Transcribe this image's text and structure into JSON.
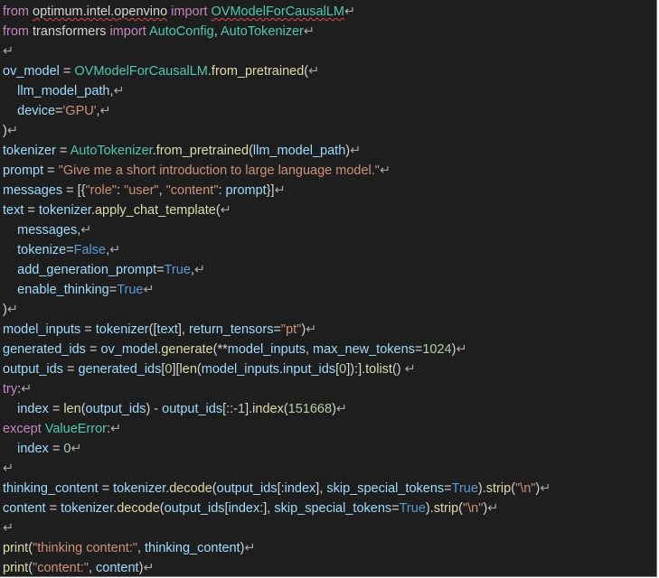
{
  "colors": {
    "background": "#1e1e1e",
    "keyword": "#c586c0",
    "text": "#d4d4d4",
    "class": "#4ec9b0",
    "function": "#dcdcaa",
    "variable": "#9cdcfe",
    "string": "#ce9178",
    "number": "#b5cea8",
    "constant": "#569cd6",
    "paragraph_mark": "#a8a8a8",
    "spellcheck_underline": "#e04848"
  },
  "paragraph_mark": "↵",
  "code_lines": [
    [
      [
        "kw",
        "from "
      ],
      [
        "text",
        "optimum.intel.openvino"
      ],
      [
        "kw",
        " import "
      ],
      [
        "cls",
        "OVModelForCausalLM"
      ]
    ],
    [
      [
        "kw",
        "from "
      ],
      [
        "text",
        "transformers"
      ],
      [
        "kw",
        " import "
      ],
      [
        "cls",
        "AutoConfig"
      ],
      [
        "text",
        ", "
      ],
      [
        "cls",
        "AutoTokenizer"
      ]
    ],
    [],
    [
      [
        "var",
        "ov_model"
      ],
      [
        "text",
        " = "
      ],
      [
        "cls",
        "OVModelForCausalLM"
      ],
      [
        "text",
        "."
      ],
      [
        "fn",
        "from_pretrained"
      ],
      [
        "text",
        "("
      ]
    ],
    [
      [
        "text",
        "    "
      ],
      [
        "var",
        "llm_model_path"
      ],
      [
        "text",
        ","
      ]
    ],
    [
      [
        "text",
        "    "
      ],
      [
        "var",
        "device"
      ],
      [
        "text",
        "="
      ],
      [
        "str",
        "'GPU'"
      ],
      [
        "text",
        ","
      ]
    ],
    [
      [
        "text",
        ")"
      ]
    ],
    [
      [
        "var",
        "tokenizer"
      ],
      [
        "text",
        " = "
      ],
      [
        "cls",
        "AutoTokenizer"
      ],
      [
        "text",
        "."
      ],
      [
        "fn",
        "from_pretrained"
      ],
      [
        "text",
        "("
      ],
      [
        "var",
        "llm_model_path"
      ],
      [
        "text",
        ")"
      ]
    ],
    [
      [
        "var",
        "prompt"
      ],
      [
        "text",
        " = "
      ],
      [
        "str",
        "\"Give me a short introduction to large language model.\""
      ]
    ],
    [
      [
        "var",
        "messages"
      ],
      [
        "text",
        " = [{"
      ],
      [
        "str",
        "\"role\""
      ],
      [
        "text",
        ": "
      ],
      [
        "str",
        "\"user\""
      ],
      [
        "text",
        ", "
      ],
      [
        "str",
        "\"content\""
      ],
      [
        "text",
        ": "
      ],
      [
        "var",
        "prompt"
      ],
      [
        "text",
        "}]"
      ]
    ],
    [
      [
        "var",
        "text"
      ],
      [
        "text",
        " = "
      ],
      [
        "var",
        "tokenizer"
      ],
      [
        "text",
        "."
      ],
      [
        "fn",
        "apply_chat_template"
      ],
      [
        "text",
        "("
      ]
    ],
    [
      [
        "text",
        "    "
      ],
      [
        "var",
        "messages"
      ],
      [
        "text",
        ","
      ]
    ],
    [
      [
        "text",
        "    "
      ],
      [
        "var",
        "tokenize"
      ],
      [
        "text",
        "="
      ],
      [
        "const",
        "False"
      ],
      [
        "text",
        ","
      ]
    ],
    [
      [
        "text",
        "    "
      ],
      [
        "var",
        "add_generation_prompt"
      ],
      [
        "text",
        "="
      ],
      [
        "const",
        "True"
      ],
      [
        "text",
        ","
      ]
    ],
    [
      [
        "text",
        "    "
      ],
      [
        "var",
        "enable_thinking"
      ],
      [
        "text",
        "="
      ],
      [
        "const",
        "True"
      ]
    ],
    [
      [
        "text",
        ")"
      ]
    ],
    [
      [
        "var",
        "model_inputs"
      ],
      [
        "text",
        " = "
      ],
      [
        "var",
        "tokenizer"
      ],
      [
        "text",
        "(["
      ],
      [
        "var",
        "text"
      ],
      [
        "text",
        "], "
      ],
      [
        "var",
        "return_tensors"
      ],
      [
        "text",
        "="
      ],
      [
        "str",
        "\"pt\""
      ],
      [
        "text",
        ")"
      ]
    ],
    [
      [
        "var",
        "generated_ids"
      ],
      [
        "text",
        " = "
      ],
      [
        "var",
        "ov_model"
      ],
      [
        "text",
        "."
      ],
      [
        "fn",
        "generate"
      ],
      [
        "text",
        "(**"
      ],
      [
        "var",
        "model_inputs"
      ],
      [
        "text",
        ", "
      ],
      [
        "var",
        "max_new_tokens"
      ],
      [
        "text",
        "="
      ],
      [
        "num",
        "1024"
      ],
      [
        "text",
        ")"
      ]
    ],
    [
      [
        "var",
        "output_ids"
      ],
      [
        "text",
        " = "
      ],
      [
        "var",
        "generated_ids"
      ],
      [
        "text",
        "["
      ],
      [
        "num",
        "0"
      ],
      [
        "text",
        "]["
      ],
      [
        "fn",
        "len"
      ],
      [
        "text",
        "("
      ],
      [
        "var",
        "model_inputs"
      ],
      [
        "text",
        "."
      ],
      [
        "var",
        "input_ids"
      ],
      [
        "text",
        "["
      ],
      [
        "num",
        "0"
      ],
      [
        "text",
        "]):]."
      ],
      [
        "fn",
        "tolist"
      ],
      [
        "text",
        "() "
      ]
    ],
    [
      [
        "kw",
        "try"
      ],
      [
        "text",
        ":"
      ]
    ],
    [
      [
        "text",
        "    "
      ],
      [
        "var",
        "index"
      ],
      [
        "text",
        " = "
      ],
      [
        "fn",
        "len"
      ],
      [
        "text",
        "("
      ],
      [
        "var",
        "output_ids"
      ],
      [
        "text",
        ") - "
      ],
      [
        "var",
        "output_ids"
      ],
      [
        "text",
        "[::-"
      ],
      [
        "num",
        "1"
      ],
      [
        "text",
        "]."
      ],
      [
        "fn",
        "index"
      ],
      [
        "text",
        "("
      ],
      [
        "num",
        "151668"
      ],
      [
        "text",
        ")"
      ]
    ],
    [
      [
        "kw",
        "except "
      ],
      [
        "cls",
        "ValueError"
      ],
      [
        "text",
        ":"
      ]
    ],
    [
      [
        "text",
        "    "
      ],
      [
        "var",
        "index"
      ],
      [
        "text",
        " = "
      ],
      [
        "num",
        "0"
      ]
    ],
    [],
    [
      [
        "var",
        "thinking_content"
      ],
      [
        "text",
        " = "
      ],
      [
        "var",
        "tokenizer"
      ],
      [
        "text",
        "."
      ],
      [
        "fn",
        "decode"
      ],
      [
        "text",
        "("
      ],
      [
        "var",
        "output_ids"
      ],
      [
        "text",
        "[:"
      ],
      [
        "var",
        "index"
      ],
      [
        "text",
        "], "
      ],
      [
        "var",
        "skip_special_tokens"
      ],
      [
        "text",
        "="
      ],
      [
        "const",
        "True"
      ],
      [
        "text",
        ")."
      ],
      [
        "fn",
        "strip"
      ],
      [
        "text",
        "("
      ],
      [
        "str",
        "\"\\n\""
      ],
      [
        "text",
        ")"
      ]
    ],
    [
      [
        "var",
        "content"
      ],
      [
        "text",
        " = "
      ],
      [
        "var",
        "tokenizer"
      ],
      [
        "text",
        "."
      ],
      [
        "fn",
        "decode"
      ],
      [
        "text",
        "("
      ],
      [
        "var",
        "output_ids"
      ],
      [
        "text",
        "["
      ],
      [
        "var",
        "index"
      ],
      [
        "text",
        ":], "
      ],
      [
        "var",
        "skip_special_tokens"
      ],
      [
        "text",
        "="
      ],
      [
        "const",
        "True"
      ],
      [
        "text",
        ")."
      ],
      [
        "fn",
        "strip"
      ],
      [
        "text",
        "("
      ],
      [
        "str",
        "\"\\n\""
      ],
      [
        "text",
        ")"
      ]
    ],
    [],
    [
      [
        "fn",
        "print"
      ],
      [
        "text",
        "("
      ],
      [
        "str",
        "\"thinking content:\""
      ],
      [
        "text",
        ", "
      ],
      [
        "var",
        "thinking_content"
      ],
      [
        "text",
        ")"
      ]
    ],
    [
      [
        "fn",
        "print"
      ],
      [
        "text",
        "("
      ],
      [
        "str",
        "\"content:\""
      ],
      [
        "text",
        ", "
      ],
      [
        "var",
        "content"
      ],
      [
        "text",
        ")"
      ]
    ]
  ]
}
